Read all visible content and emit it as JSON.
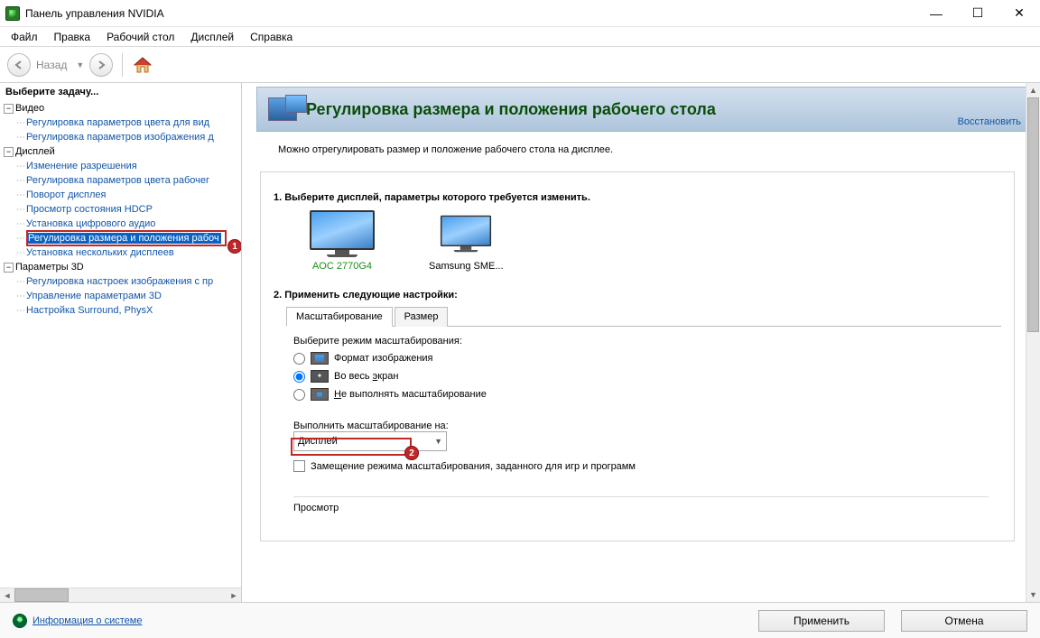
{
  "window": {
    "title": "Панель управления NVIDIA"
  },
  "menu": {
    "file": "Файл",
    "edit": "Правка",
    "desktop": "Рабочий стол",
    "display": "Дисплей",
    "help": "Справка"
  },
  "toolbar": {
    "back": "Назад"
  },
  "sidebar": {
    "task_prompt": "Выберите задачу...",
    "cat_video": "Видео",
    "video_items": [
      "Регулировка параметров цвета для вид",
      "Регулировка параметров изображения д"
    ],
    "cat_display": "Дисплей",
    "display_items": [
      "Изменение разрешения",
      "Регулировка параметров цвета рабочег",
      "Поворот дисплея",
      "Просмотр состояния HDCP",
      "Установка цифрового аудио",
      "Регулировка размера и положения рабоч",
      "Установка нескольких дисплеев"
    ],
    "cat_3d": "Параметры 3D",
    "three_d_items": [
      "Регулировка настроек изображения с пр",
      "Управление параметрами 3D",
      "Настройка Surround, PhysX"
    ]
  },
  "badges": {
    "one": "1",
    "two": "2"
  },
  "page": {
    "title": "Регулировка размера и положения рабочего стола",
    "restore": "Восстановить",
    "intro": "Можно отрегулировать размер и положение рабочего стола на дисплее.",
    "step1": "1. Выберите дисплей, параметры которого требуется изменить.",
    "display1": "AOC 2770G4",
    "display2": "Samsung SME...",
    "step2": "2. Применить следующие настройки:",
    "tab_scaling": "Масштабирование",
    "tab_size": "Размер",
    "scaling_prompt": "Выберите режим масштабирования:",
    "opt_aspect": "Формат изображения",
    "opt_full_pre": "Во весь ",
    "opt_full_u": "э",
    "opt_full_post": "кран",
    "opt_none_pre": "",
    "opt_none_u": "Н",
    "opt_none_post": "е выполнять масштабирование",
    "perform_on": "Выполнить масштабирование на:",
    "perform_val": "Дисплей",
    "override": "Замещение режима масштабирования, заданного для игр и программ",
    "preview": "Просмотр"
  },
  "footer": {
    "sysinfo": "Информация о системе",
    "apply": "Применить",
    "cancel": "Отмена"
  }
}
